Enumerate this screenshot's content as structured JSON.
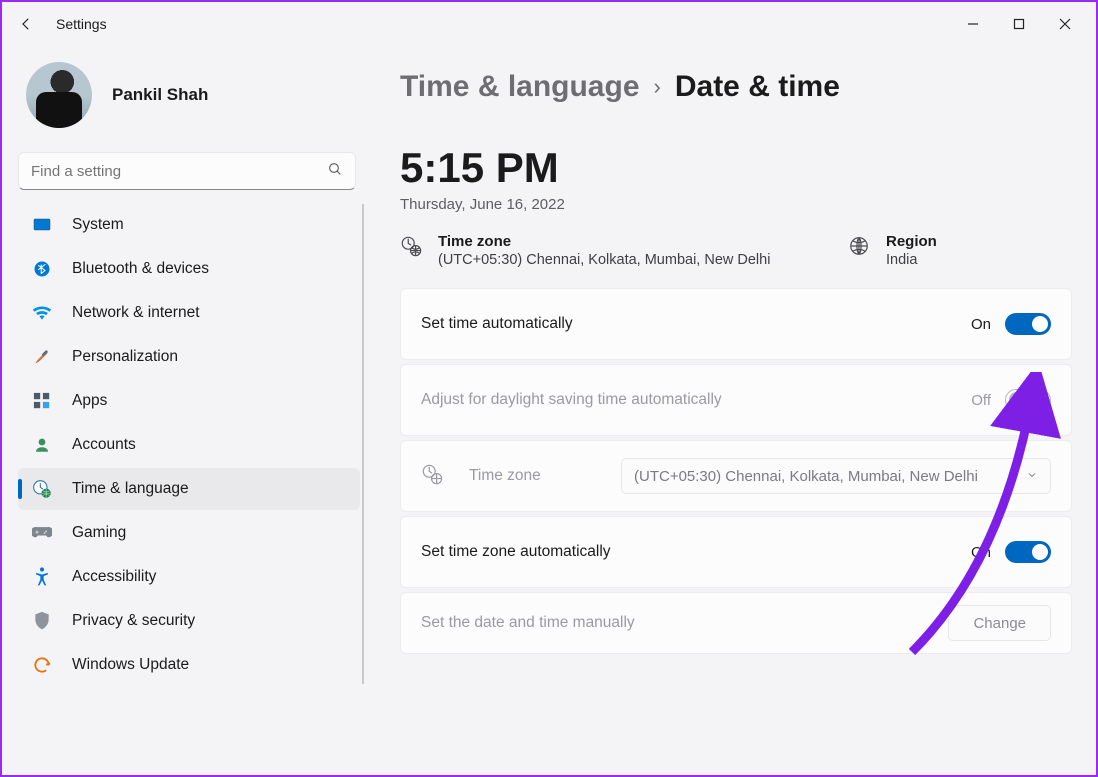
{
  "window": {
    "title": "Settings"
  },
  "user": {
    "name": "Pankil Shah"
  },
  "search": {
    "placeholder": "Find a setting"
  },
  "nav": {
    "items": [
      {
        "label": "System"
      },
      {
        "label": "Bluetooth & devices"
      },
      {
        "label": "Network & internet"
      },
      {
        "label": "Personalization"
      },
      {
        "label": "Apps"
      },
      {
        "label": "Accounts"
      },
      {
        "label": "Time & language"
      },
      {
        "label": "Gaming"
      },
      {
        "label": "Accessibility"
      },
      {
        "label": "Privacy & security"
      },
      {
        "label": "Windows Update"
      }
    ]
  },
  "breadcrumb": {
    "parent": "Time & language",
    "current": "Date & time"
  },
  "clock": {
    "time": "5:15 PM",
    "date": "Thursday, June 16, 2022"
  },
  "info": {
    "timezone": {
      "heading": "Time zone",
      "value": "(UTC+05:30) Chennai, Kolkata, Mumbai, New Delhi"
    },
    "region": {
      "heading": "Region",
      "value": "India"
    }
  },
  "cards": {
    "set_auto": {
      "label": "Set time automatically",
      "state": "On"
    },
    "dst": {
      "label": "Adjust for daylight saving time automatically",
      "state": "Off"
    },
    "tz": {
      "label": "Time zone",
      "selected": "(UTC+05:30) Chennai, Kolkata, Mumbai, New Delhi"
    },
    "tz_auto": {
      "label": "Set time zone automatically",
      "state": "On"
    },
    "manual": {
      "label": "Set the date and time manually",
      "button": "Change"
    }
  },
  "colors": {
    "accent": "#0067c0",
    "arrow": "#7e1fe6"
  }
}
